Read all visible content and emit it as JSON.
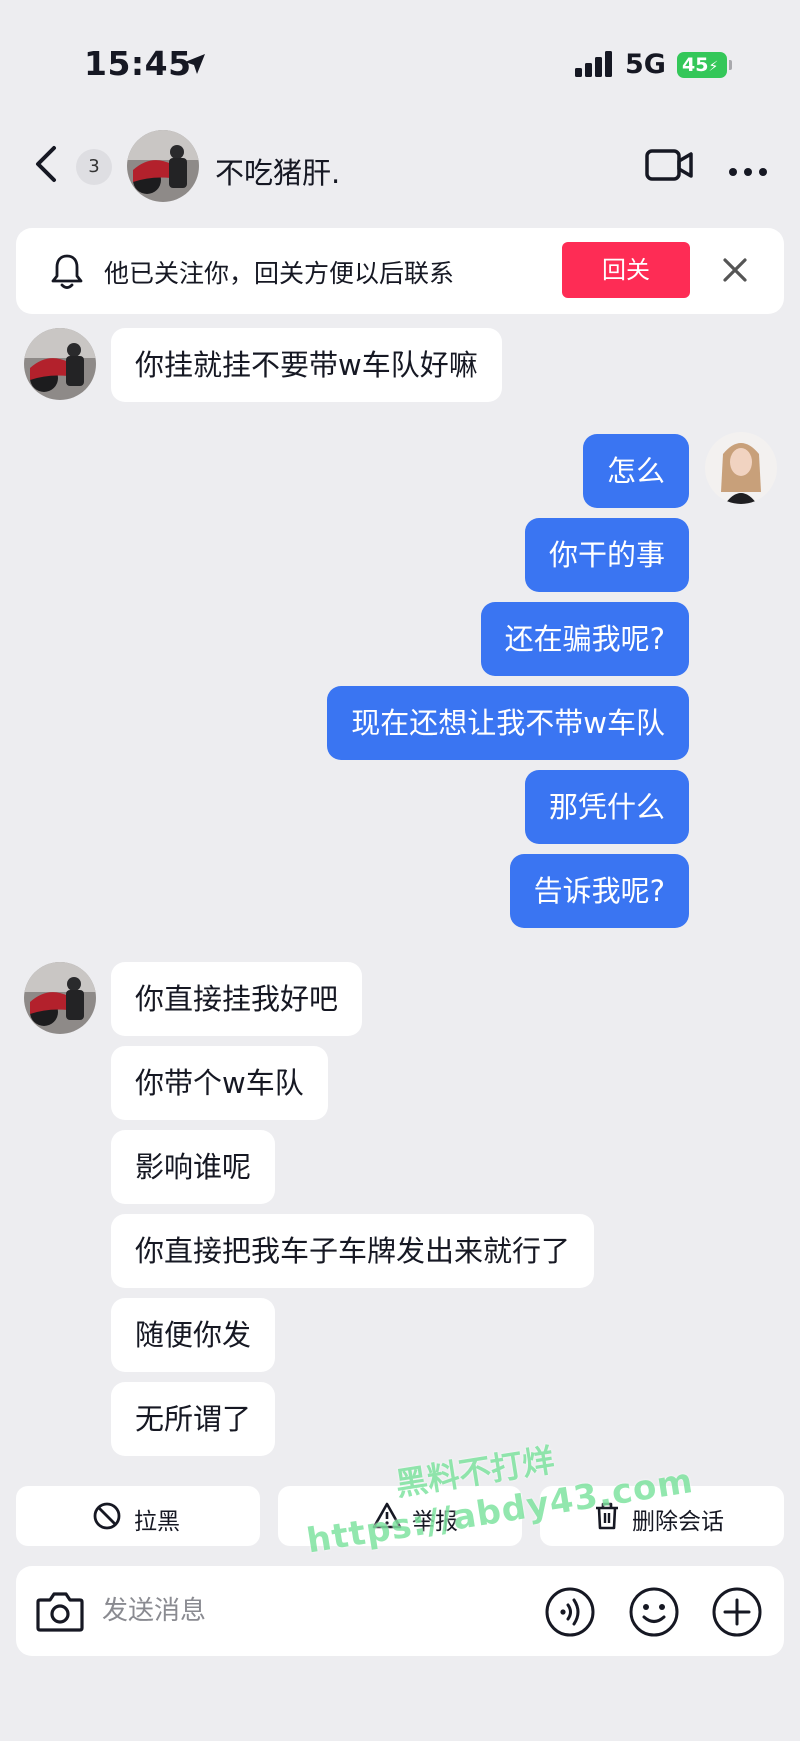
{
  "status_bar": {
    "time": "15:45",
    "network": "5G",
    "battery": "45"
  },
  "header": {
    "unread_count": "3",
    "title": "不吃猪肝."
  },
  "follow_banner": {
    "text": "他已关注你，回关方便以后联系",
    "button": "回关"
  },
  "messages": [
    {
      "side": "in",
      "text": "你挂就挂不要带w车队好嘛"
    },
    {
      "side": "out",
      "text": "怎么"
    },
    {
      "side": "out",
      "text": "你干的事"
    },
    {
      "side": "out",
      "text": "还在骗我呢?"
    },
    {
      "side": "out",
      "text": "现在还想让我不带w车队"
    },
    {
      "side": "out",
      "text": "那凭什么"
    },
    {
      "side": "out",
      "text": "告诉我呢?"
    },
    {
      "side": "in",
      "text": "你直接挂我好吧"
    },
    {
      "side": "in",
      "text": "你带个w车队"
    },
    {
      "side": "in",
      "text": "影响谁呢"
    },
    {
      "side": "in",
      "text": "你直接把我车子车牌发出来就行了"
    },
    {
      "side": "in",
      "text": "随便你发"
    },
    {
      "side": "in",
      "text": "无所谓了"
    }
  ],
  "actions": {
    "block": "拉黑",
    "report": "举报",
    "delete": "删除会话"
  },
  "input": {
    "placeholder": "发送消息"
  },
  "watermark": {
    "line1": "黑料不打烊",
    "line2": "https://abdy43.com"
  },
  "colors": {
    "outgoing_bubble": "#3a75f2",
    "incoming_bubble": "#ffffff",
    "follow_button": "#fe2c55",
    "background": "#ededf0",
    "battery": "#34c759"
  }
}
